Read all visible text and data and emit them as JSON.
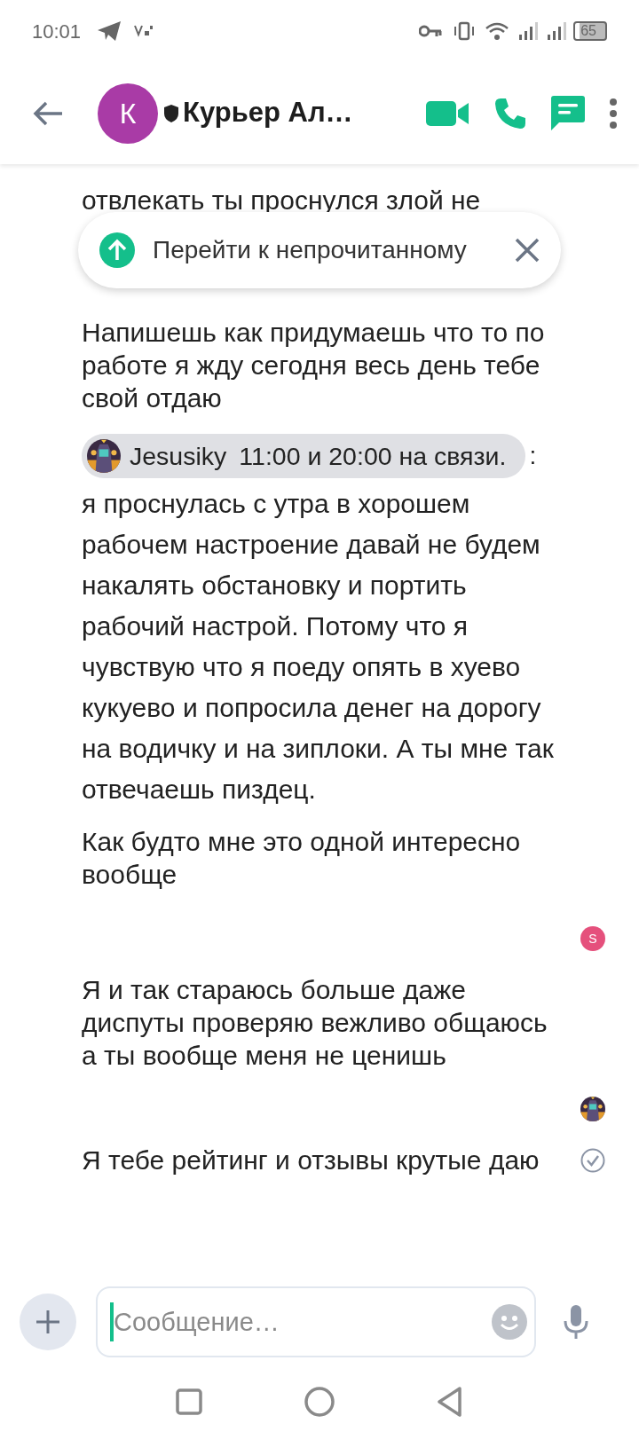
{
  "status_bar": {
    "time": "10:01",
    "battery": "65"
  },
  "header": {
    "avatar_letter": "К",
    "title": "Курьер Ал…"
  },
  "unread_banner": {
    "label": "Перейти к непрочитанному"
  },
  "messages": [
    {
      "kind": "partial",
      "lines": [
        "отвлекать ты проснулся злой не"
      ]
    },
    {
      "kind": "text",
      "text": "Напишешь как придумаешь что то по работе я жду сегодня весь день тебе свой отдаю"
    },
    {
      "kind": "mention",
      "name": "Jesusiky",
      "quote": "11:00 и 20:00 на связи.",
      "separator": ":",
      "text": "я проснулась с утра в хорошем рабочем настроение давай не будем накалять обстановку и портить рабочий настрой. Потому что я чувствую что я поеду опять в хуево кукуево и попросила денег на дорогу на водичку и на зиплоки. А ты мне так отвечаешь пиздец."
    },
    {
      "kind": "text",
      "text": "Как будто мне это одной интересно вообще"
    },
    {
      "kind": "reader",
      "letter": "S",
      "color": "#e5507c"
    },
    {
      "kind": "text",
      "text": "Я и так стараюсь больше даже диспуты проверяю вежливо общаюсь а ты вообще меня не ценишь"
    },
    {
      "kind": "reader_picture"
    },
    {
      "kind": "text",
      "text": "Я тебе рейтинг и отзывы крутые даю",
      "delivered": true
    }
  ],
  "composer": {
    "placeholder": "Сообщение…"
  }
}
